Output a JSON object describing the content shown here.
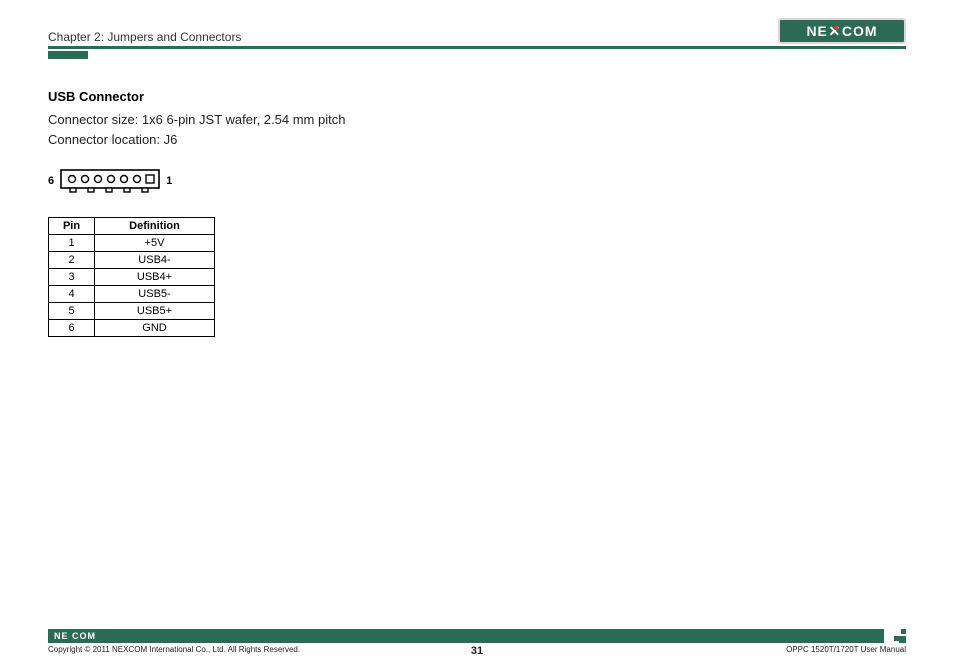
{
  "header": {
    "chapter": "Chapter 2: Jumpers and Connectors",
    "logo_ne": "NE",
    "logo_x": "X",
    "logo_com": "COM"
  },
  "section": {
    "title": "USB Connector",
    "size_line": "Connector size:  1x6 6-pin JST wafer, 2.54 mm pitch",
    "location_line": "Connector location: J6"
  },
  "connector": {
    "left_label": "6",
    "right_label": "1"
  },
  "table": {
    "col_pin": "Pin",
    "col_def": "Definition",
    "rows": [
      {
        "pin": "1",
        "def": "+5V"
      },
      {
        "pin": "2",
        "def": "USB4-"
      },
      {
        "pin": "3",
        "def": "USB4+"
      },
      {
        "pin": "4",
        "def": "USB5-"
      },
      {
        "pin": "5",
        "def": "USB5+"
      },
      {
        "pin": "6",
        "def": "GND"
      }
    ]
  },
  "footer": {
    "logo": "NE COM",
    "copyright": "Copyright © 2011 NEXCOM International Co., Ltd. All Rights Reserved.",
    "page_number": "31",
    "manual": "OPPC 1520T/1720T User Manual"
  }
}
